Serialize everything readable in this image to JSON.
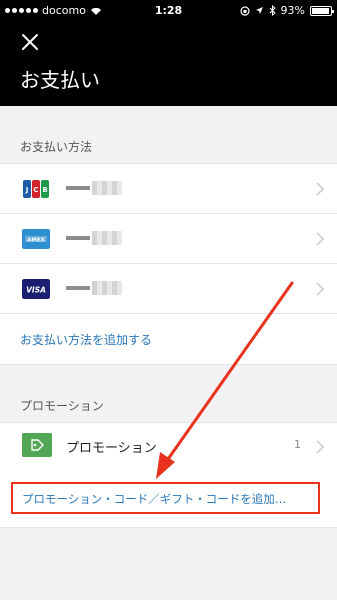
{
  "status_bar": {
    "carrier": "docomo",
    "time": "1:28",
    "battery": "93%",
    "battery_level": 0.93,
    "icons": [
      "signal-dots",
      "wifi-icon",
      "rotation-lock-icon",
      "location-icon",
      "bluetooth-icon",
      "battery-icon"
    ]
  },
  "header": {
    "close_icon": "close-icon",
    "title": "お支払い"
  },
  "payment": {
    "section_label": "お支払い方法",
    "cards": [
      {
        "brand": "JCB",
        "icon": "jcb-card-icon"
      },
      {
        "brand": "AMEX",
        "icon": "amex-card-icon"
      },
      {
        "brand": "VISA",
        "icon": "visa-card-icon"
      }
    ],
    "add_label": "お支払い方法を追加する"
  },
  "promotion": {
    "section_label": "プロモーション",
    "item_label": "プロモーション",
    "item_count": "1",
    "link_label": "プロモーション・コード／ギフト・コードを追加…"
  },
  "colors": {
    "header_bg": "#000000",
    "link": "#2876b8",
    "promo_icon": "#53a653",
    "highlight": "#e8321e"
  }
}
